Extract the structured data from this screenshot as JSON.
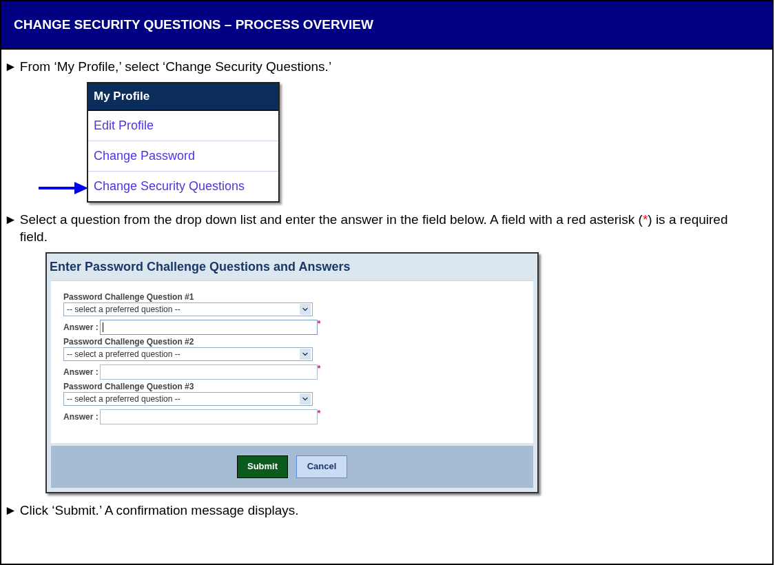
{
  "header": {
    "title": "CHANGE SECURITY QUESTIONS – PROCESS OVERVIEW"
  },
  "steps": [
    {
      "kind": "menu",
      "bullet": "►",
      "parts": [
        "From ‘My Profile,’ select ‘Change Security Questions.’"
      ],
      "menu": {
        "title": "My Profile",
        "items": [
          {
            "label": "Edit Profile"
          },
          {
            "label": "Change Password"
          },
          {
            "label": "Change Security Questions"
          }
        ]
      }
    },
    {
      "kind": "form",
      "bullet": "►",
      "parts": [
        "Select a question from the drop down list and enter the answer in the field below. A field with a red asterisk (",
        "*",
        ") is a required field."
      ],
      "form": {
        "title": "Enter Password Challenge Questions and Answers",
        "questions": [
          {
            "label": "Password Challenge Question #1",
            "select": "-- select a preferred question --",
            "answer_label": "Answer :",
            "required": "*",
            "focused": true
          },
          {
            "label": "Password Challenge Question #2",
            "select": "-- select a preferred question --",
            "answer_label": "Answer :",
            "required": "*",
            "focused": false
          },
          {
            "label": "Password Challenge Question #3",
            "select": "-- select a preferred question --",
            "answer_label": "Answer :",
            "required": "*",
            "focused": false
          }
        ],
        "buttons": [
          {
            "label": "Submit",
            "kind": "primary"
          },
          {
            "label": "Cancel",
            "kind": "secondary"
          }
        ]
      }
    },
    {
      "kind": "text",
      "bullet": "►",
      "parts": [
        "Click ‘Submit.’ A confirmation message displays."
      ]
    }
  ]
}
